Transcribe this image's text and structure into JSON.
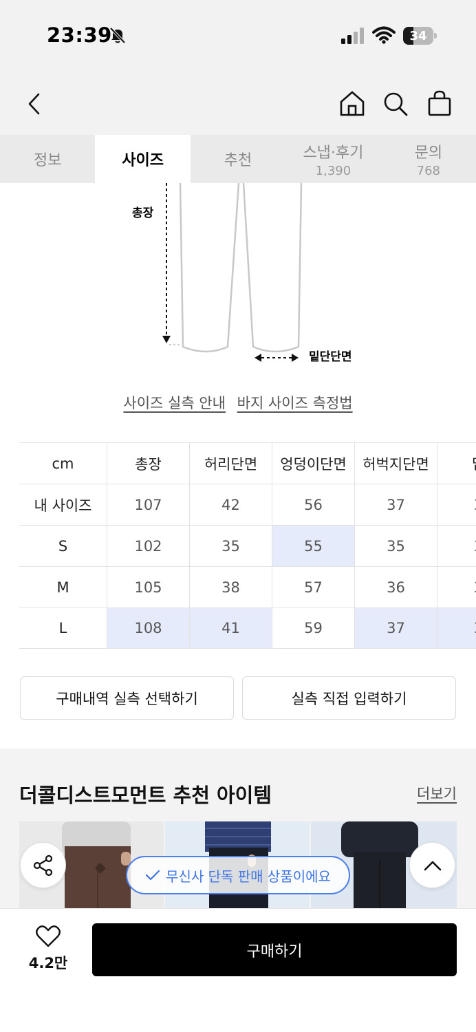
{
  "status_bar": {
    "time": "23:39",
    "battery": "34",
    "battery_level": 0.34,
    "icons": [
      "bell-off-icon",
      "signal-icon",
      "wifi-icon",
      "battery-icon"
    ]
  },
  "header": {
    "icons": [
      "back-icon",
      "home-icon",
      "search-icon",
      "shopping-bag-icon"
    ]
  },
  "tabs": [
    {
      "label": "정보",
      "count": ""
    },
    {
      "label": "사이즈",
      "count": ""
    },
    {
      "label": "추천",
      "count": ""
    },
    {
      "label": "스냅·후기",
      "count": "1,390"
    },
    {
      "label": "문의",
      "count": "768"
    }
  ],
  "active_tab": "사이즈",
  "diagram": {
    "length_label": "총장",
    "hem_label": "밑단단면"
  },
  "links": {
    "size_guide": "사이즈 실측 안내",
    "measure_guide": "바지 사이즈 측정법"
  },
  "size_table": {
    "columns": [
      "cm",
      "총장",
      "허리단면",
      "엉덩이단면",
      "허벅지단면",
      "밑"
    ],
    "rows": [
      {
        "label": "내 사이즈",
        "values": [
          "107",
          "42",
          "56",
          "37",
          "3"
        ]
      },
      {
        "label": "S",
        "values": [
          "102",
          "35",
          "55",
          "35",
          "3"
        ]
      },
      {
        "label": "M",
        "values": [
          "105",
          "38",
          "57",
          "36",
          "3"
        ]
      },
      {
        "label": "L",
        "values": [
          "108",
          "41",
          "59",
          "37",
          "3"
        ]
      }
    ]
  },
  "buttons": {
    "purchase_history": "구매내역 실측 선택하기",
    "manual_input": "실측 직접 입력하기"
  },
  "recommend": {
    "title": "더콜디스트모먼트 추천 아이템",
    "more": "더보기"
  },
  "exclusive_badge": "무신사 단독 판매 상품이에요",
  "bottom": {
    "like_count": "4.2만",
    "buy_label": "구매하기"
  },
  "colors": {
    "accent_blue": "#3e74e6",
    "highlight": "#e6ebfb",
    "buy_button": "#000000"
  }
}
